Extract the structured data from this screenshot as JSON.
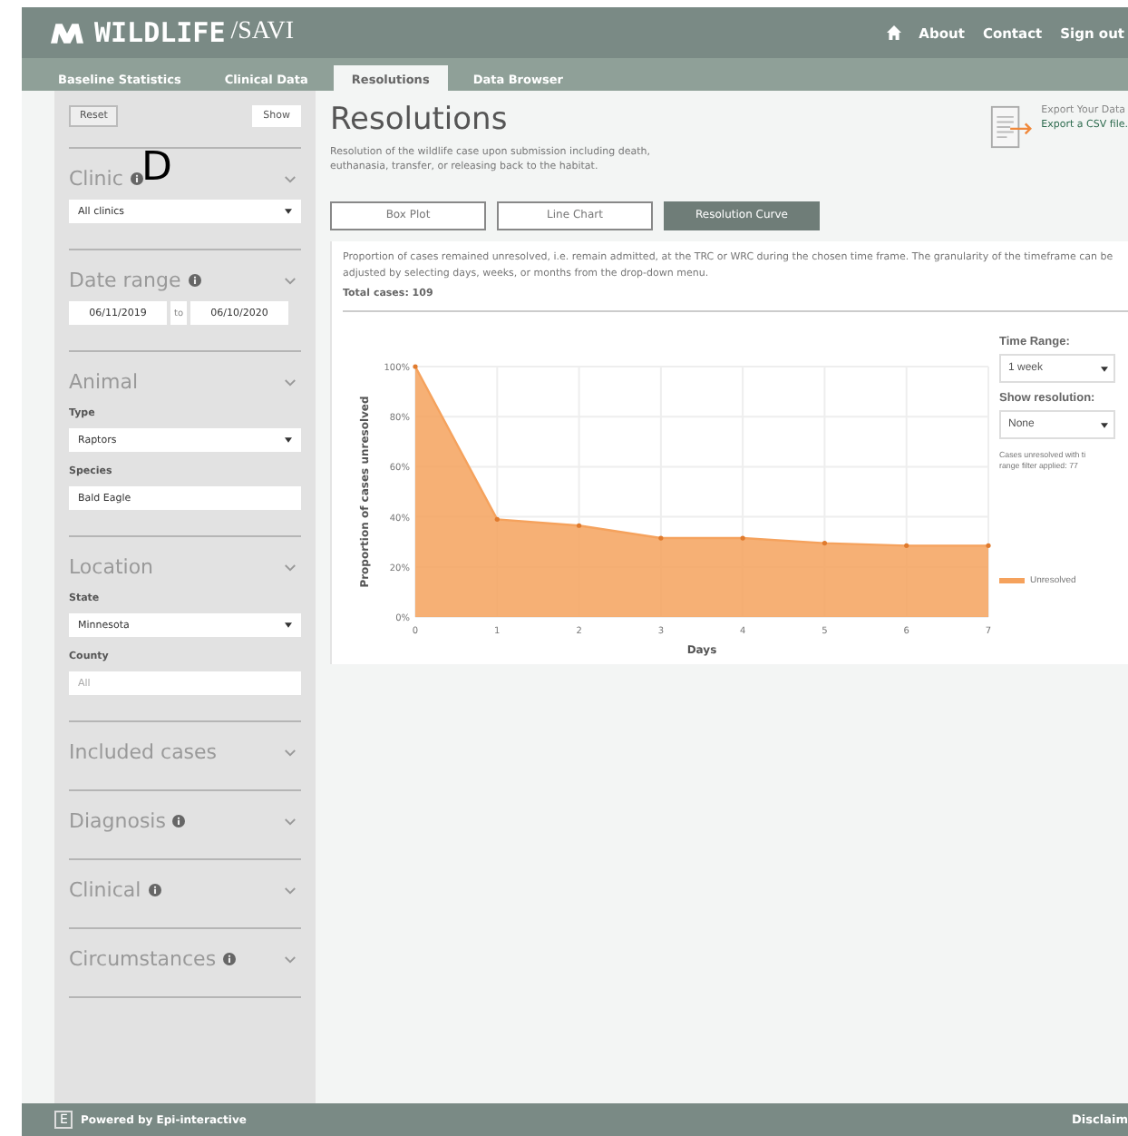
{
  "header": {
    "brand": "WILDLIFE",
    "separator": "/",
    "sub": "SAVI",
    "links": [
      "About",
      "Contact",
      "Sign out"
    ]
  },
  "nav": [
    {
      "label": "Baseline Statistics",
      "selected": false
    },
    {
      "label": "Clinical Data",
      "selected": false
    },
    {
      "label": "Resolutions",
      "selected": true
    },
    {
      "label": "Data Browser",
      "selected": false
    }
  ],
  "overlay_label": "D",
  "sidebar": {
    "reset": "Reset",
    "show": "Show",
    "sections": [
      {
        "title": "Clinic",
        "info": true,
        "fields": [
          {
            "kind": "select",
            "value": "All clinics"
          }
        ]
      },
      {
        "title": "Date range",
        "info": true,
        "fields": [
          {
            "kind": "daterange",
            "from": "06/11/2019",
            "sep": "to",
            "to": "06/10/2020"
          }
        ]
      },
      {
        "title": "Animal",
        "info": false,
        "fields": [
          {
            "kind": "select",
            "label": "Type",
            "value": "Raptors"
          },
          {
            "kind": "input",
            "label": "Species",
            "value": "Bald Eagle"
          }
        ]
      },
      {
        "title": "Location",
        "info": false,
        "fields": [
          {
            "kind": "select",
            "label": "State",
            "value": "Minnesota"
          },
          {
            "kind": "input",
            "label": "County",
            "placeholder": "All"
          }
        ]
      },
      {
        "title": "Included cases",
        "info": false
      },
      {
        "title": "Diagnosis",
        "info": true
      },
      {
        "title": "Clinical",
        "info": true
      },
      {
        "title": "Circumstances",
        "info": true
      }
    ]
  },
  "main": {
    "title": "Resolutions",
    "description": "Resolution of the wildlife case upon submission including death, euthanasia, transfer, or releasing back to the habitat.",
    "export": {
      "title": "Export Your Data",
      "link": "Export a CSV file."
    },
    "chart_tabs": [
      {
        "label": "Box Plot",
        "selected": false
      },
      {
        "label": "Line Chart",
        "selected": false
      },
      {
        "label": "Resolution Curve",
        "selected": true
      }
    ],
    "intro": "Proportion of cases remained unresolved, i.e. remain admitted, at the TRC or WRC during the chosen time frame. The granularity of the timeframe can be adjusted by selecting days, weeks, or months from the drop-down menu.",
    "total": "Total cases: 109",
    "controls": {
      "time_range_label": "Time Range:",
      "time_range": "1 week",
      "show_label": "Show resolution:",
      "show": "None",
      "note_lines": [
        "Cases unresolved with ti",
        "range filter applied: 77"
      ]
    },
    "chart_data": {
      "type": "area",
      "grid": true,
      "xlabel": "Days",
      "ylabel": "Proportion of cases unresolved",
      "x": [
        0,
        1,
        2,
        3,
        4,
        5,
        6,
        7
      ],
      "series": [
        {
          "name": "Unresolved",
          "color": "#f5a25d",
          "values": [
            100,
            39,
            36.5,
            31.5,
            31.5,
            29.5,
            28.5,
            28.5
          ]
        }
      ],
      "xlim": [
        0,
        7
      ],
      "ylim": [
        0,
        100
      ],
      "xticks": [
        0,
        1,
        2,
        3,
        4,
        5,
        6,
        7
      ],
      "yticks": [
        {
          "value": 0,
          "label": "0%"
        },
        {
          "value": 20,
          "label": "20%"
        },
        {
          "value": 40,
          "label": "40%"
        },
        {
          "value": 60,
          "label": "60%"
        },
        {
          "value": 80,
          "label": "80%"
        },
        {
          "value": 100,
          "label": "100%"
        }
      ]
    }
  },
  "footer": {
    "logo": "E",
    "powered": "Powered by Epi-interactive",
    "disclaimer": "Disclaim"
  }
}
